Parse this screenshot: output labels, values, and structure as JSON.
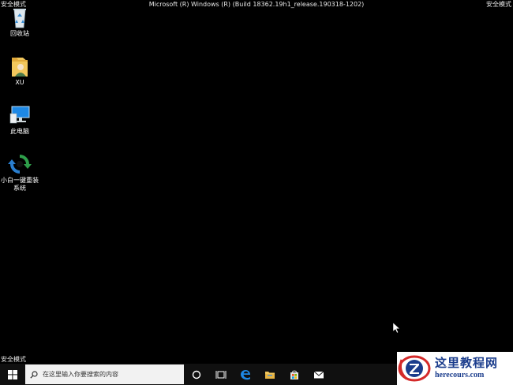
{
  "safe_mode_label": "安全模式",
  "build_info": "Microsoft (R) Windows (R) (Build 18362.19h1_release.190318-1202)",
  "desktop_icons": [
    {
      "label": "回收站",
      "icon": "recycle-bin-icon"
    },
    {
      "label": "XU",
      "icon": "user-folder-icon"
    },
    {
      "label": "此电脑",
      "icon": "this-pc-icon"
    },
    {
      "label": "小白一键重装系统",
      "icon": "xiaobai-reinstall-icon"
    }
  ],
  "taskbar": {
    "search_placeholder": "在这里输入你要搜索的内容",
    "apps": [
      "cortana-icon",
      "task-view-icon",
      "edge-icon",
      "file-explorer-icon",
      "store-icon",
      "mail-icon"
    ]
  },
  "watermark": {
    "title": "这里教程网",
    "url": "herecours.com"
  },
  "colors": {
    "desktop_bg": "#000000",
    "taskbar_bg": "#101010",
    "search_bg": "#f2f2f2",
    "edge_blue": "#1e88e5",
    "watermark_blue": "#1a3c8c",
    "watermark_red": "#d42a2a"
  }
}
